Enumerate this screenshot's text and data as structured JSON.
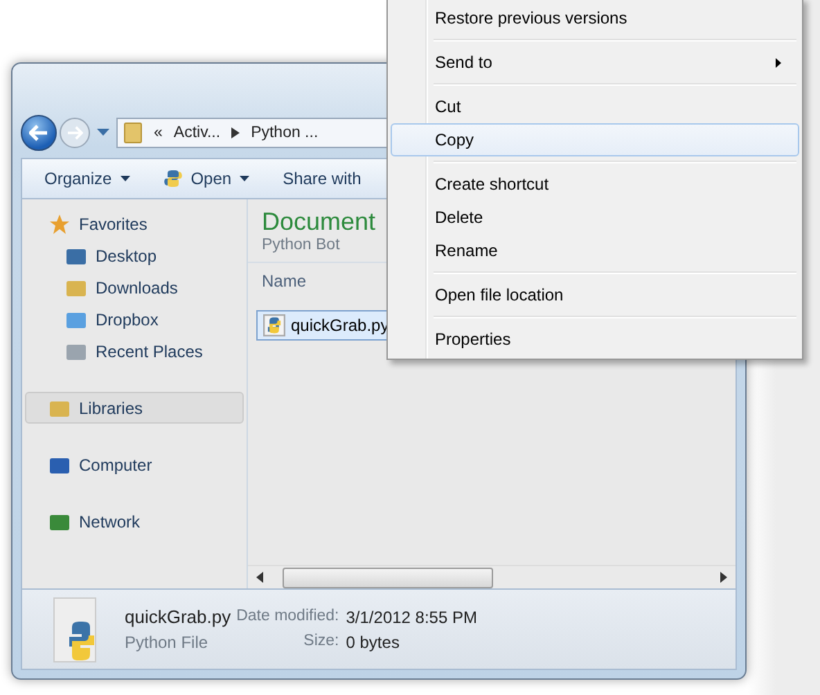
{
  "window": {
    "breadcrumb": [
      {
        "label": "«"
      },
      {
        "label": "Activ..."
      },
      {
        "label": "Python ..."
      }
    ]
  },
  "toolbar": [
    {
      "label": "Organize",
      "dropdown": true
    },
    {
      "label": "Open",
      "dropdown": true
    },
    {
      "label": "Share with",
      "dropdown": false
    }
  ],
  "sidebar": {
    "groups": [
      {
        "label": "Favorites",
        "selected": false,
        "children": [
          {
            "label": "Desktop"
          },
          {
            "label": "Downloads"
          },
          {
            "label": "Dropbox"
          },
          {
            "label": "Recent Places"
          }
        ]
      },
      {
        "label": "Libraries",
        "selected": true
      },
      {
        "label": "Computer",
        "selected": false
      },
      {
        "label": "Network",
        "selected": false
      }
    ]
  },
  "library": {
    "title": "Document",
    "subtitle": "Python Bot"
  },
  "columns": [
    "Name"
  ],
  "files": [
    {
      "name": "quickGrab.py",
      "selected": true
    }
  ],
  "details": {
    "name": "quickGrab.py",
    "type": "Python File",
    "fields": [
      {
        "label": "Date modified:",
        "value": "3/1/2012 8:55 PM"
      },
      {
        "label": "Size:",
        "value": "0 bytes"
      }
    ]
  },
  "context_menu": [
    {
      "kind": "item",
      "label": "Restore previous versions",
      "selected": false,
      "submenu": false
    },
    {
      "kind": "separator"
    },
    {
      "kind": "item",
      "label": "Send to",
      "selected": false,
      "submenu": true
    },
    {
      "kind": "separator"
    },
    {
      "kind": "item",
      "label": "Cut",
      "selected": false,
      "submenu": false
    },
    {
      "kind": "item",
      "label": "Copy",
      "selected": true,
      "submenu": false
    },
    {
      "kind": "separator"
    },
    {
      "kind": "item",
      "label": "Create shortcut",
      "selected": false,
      "submenu": false
    },
    {
      "kind": "item",
      "label": "Delete",
      "selected": false,
      "submenu": false
    },
    {
      "kind": "item",
      "label": "Rename",
      "selected": false,
      "submenu": false
    },
    {
      "kind": "separator"
    },
    {
      "kind": "item",
      "label": "Open file location",
      "selected": false,
      "submenu": false
    },
    {
      "kind": "separator"
    },
    {
      "kind": "item",
      "label": "Properties",
      "selected": false,
      "submenu": false
    }
  ]
}
